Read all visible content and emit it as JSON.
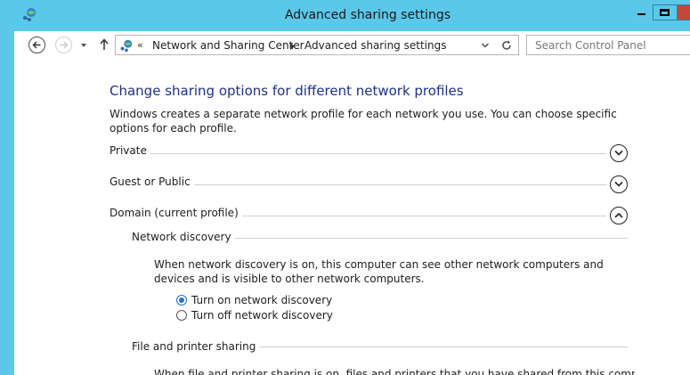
{
  "window": {
    "title": "Advanced sharing settings",
    "accent": "#5bc8ea",
    "app_icon": "network-sharing-icon",
    "controls": [
      "minimize-icon",
      "maximize-icon",
      "close-icon"
    ]
  },
  "address_bar": {
    "back_icon": "arrow-left-icon",
    "forward_icon": "arrow-right-icon",
    "recent_icon": "chevron-down-icon",
    "up_icon": "arrow-up-icon",
    "overflow": "«",
    "breadcrumbs": [
      "Network and Sharing Center",
      "Advanced sharing settings"
    ],
    "refresh_icon": "refresh-icon",
    "search_placeholder": "Search Control Panel"
  },
  "main": {
    "title": "Change sharing options for different network profiles",
    "title_color": "#1e3287",
    "intro": "Windows creates a separate network profile for each network you use. You can choose specific options for each profile.",
    "profiles": [
      {
        "label": "Private",
        "expanded": false
      },
      {
        "label": "Guest or Public",
        "expanded": false
      },
      {
        "label": "Domain (current profile)",
        "expanded": true
      }
    ],
    "sections": [
      {
        "title": "Network discovery",
        "description": "When network discovery is on, this computer can see other network computers and devices and is visible to other network computers.",
        "options": [
          {
            "label": "Turn on network discovery",
            "selected": true
          },
          {
            "label": "Turn off network discovery",
            "selected": false
          }
        ]
      },
      {
        "title": "File and printer sharing",
        "description": "When file and printer sharing is on, files and printers that you have shared from this computer can"
      }
    ]
  }
}
